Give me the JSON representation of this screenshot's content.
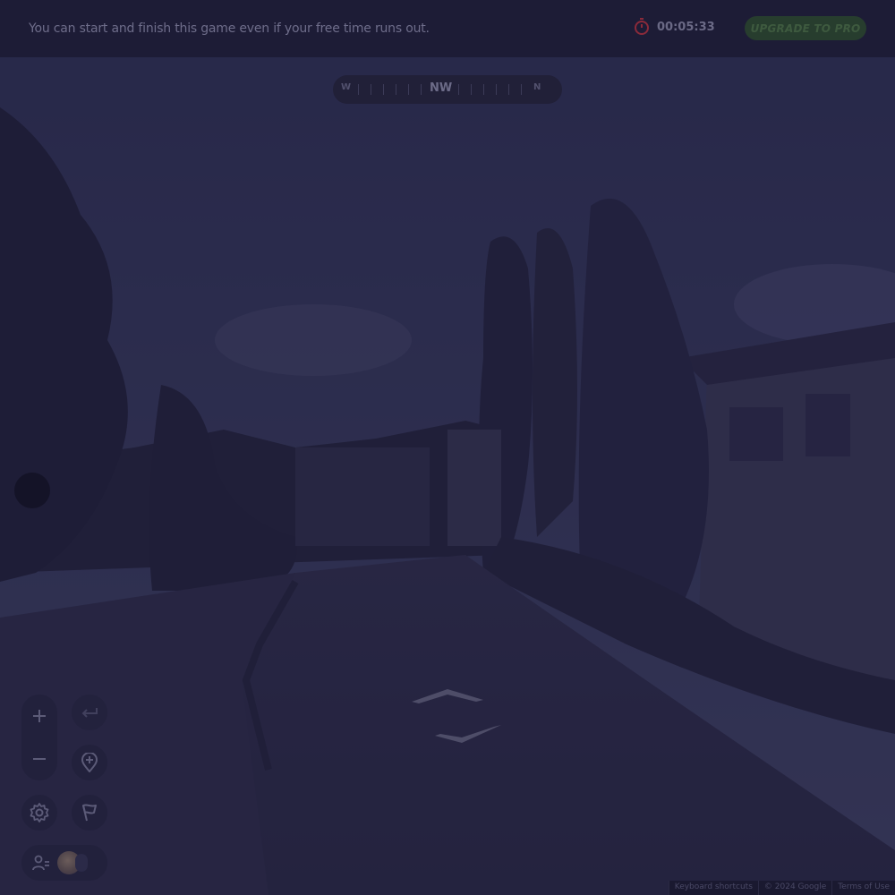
{
  "banner": {
    "message": "You can start and finish this game even if your free time runs out.",
    "timer": "00:05:33",
    "upgrade_label": "UPGRADE TO PRO"
  },
  "compass": {
    "left": "W",
    "center": "NW",
    "right": "N"
  },
  "controls": {
    "zoom_in": "+",
    "zoom_out": "−"
  },
  "footer": {
    "shortcuts": "Keyboard shortcuts",
    "copyright": "© 2024 Google",
    "terms": "Terms of Use"
  },
  "icons": [
    "stopwatch-icon",
    "plus-icon",
    "minus-icon",
    "undo-icon",
    "pin-icon",
    "settings-icon",
    "flag-icon",
    "players-icon",
    "avatar"
  ],
  "colors": {
    "banner_bg": "#1d1c36",
    "upgrade_bg": "#273d2e",
    "timer_icon": "#8b2a3a"
  }
}
